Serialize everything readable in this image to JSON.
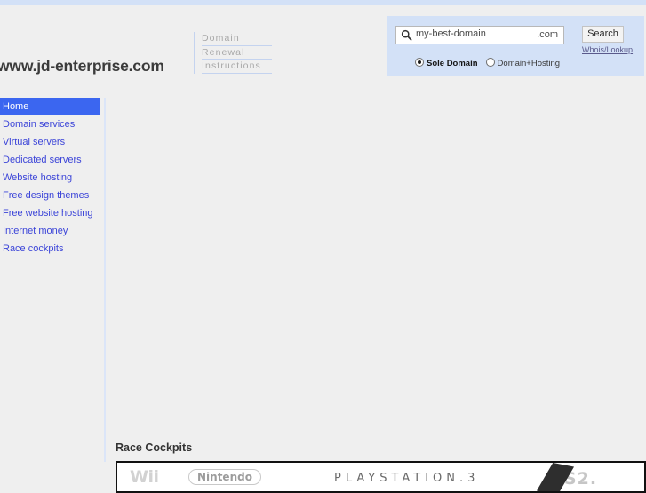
{
  "top_strip": {
    "color": "#d3e1f7"
  },
  "header": {
    "site_title": "www.jd-enterprise.com",
    "renewal_link": {
      "line1": "Domain",
      "line2": "Renewal",
      "line3": "Instructions"
    }
  },
  "search_panel": {
    "background": "#d3e1f7",
    "search_icon": "search-icon",
    "domain_value": "my-best-domain",
    "domain_placeholder": "my-best-domain",
    "tld_suffix": ".com",
    "search_button": "Search",
    "whois_link": "Whois/Lookup",
    "options": [
      {
        "label": "Sole Domain",
        "selected": true
      },
      {
        "label": "Domain+Hosting",
        "selected": false
      }
    ]
  },
  "sidebar": {
    "items": [
      {
        "label": "Home",
        "active": true
      },
      {
        "label": "Domain services",
        "active": false
      },
      {
        "label": "Virtual servers",
        "active": false
      },
      {
        "label": "Dedicated servers",
        "active": false
      },
      {
        "label": "Website hosting",
        "active": false
      },
      {
        "label": "Free design themes",
        "active": false
      },
      {
        "label": "Free website hosting",
        "active": false
      },
      {
        "label": "Internet money",
        "active": false
      },
      {
        "label": "Race cockpits",
        "active": false
      }
    ],
    "link_color": "#3b44d8",
    "active_background": "#3b66f0"
  },
  "main": {
    "section_heading": "Race Cockpits",
    "banner": {
      "wii": "Wii",
      "nintendo": "Nintendo",
      "ps3": "PLAYSTATION.3",
      "ps2": "PS2."
    }
  }
}
